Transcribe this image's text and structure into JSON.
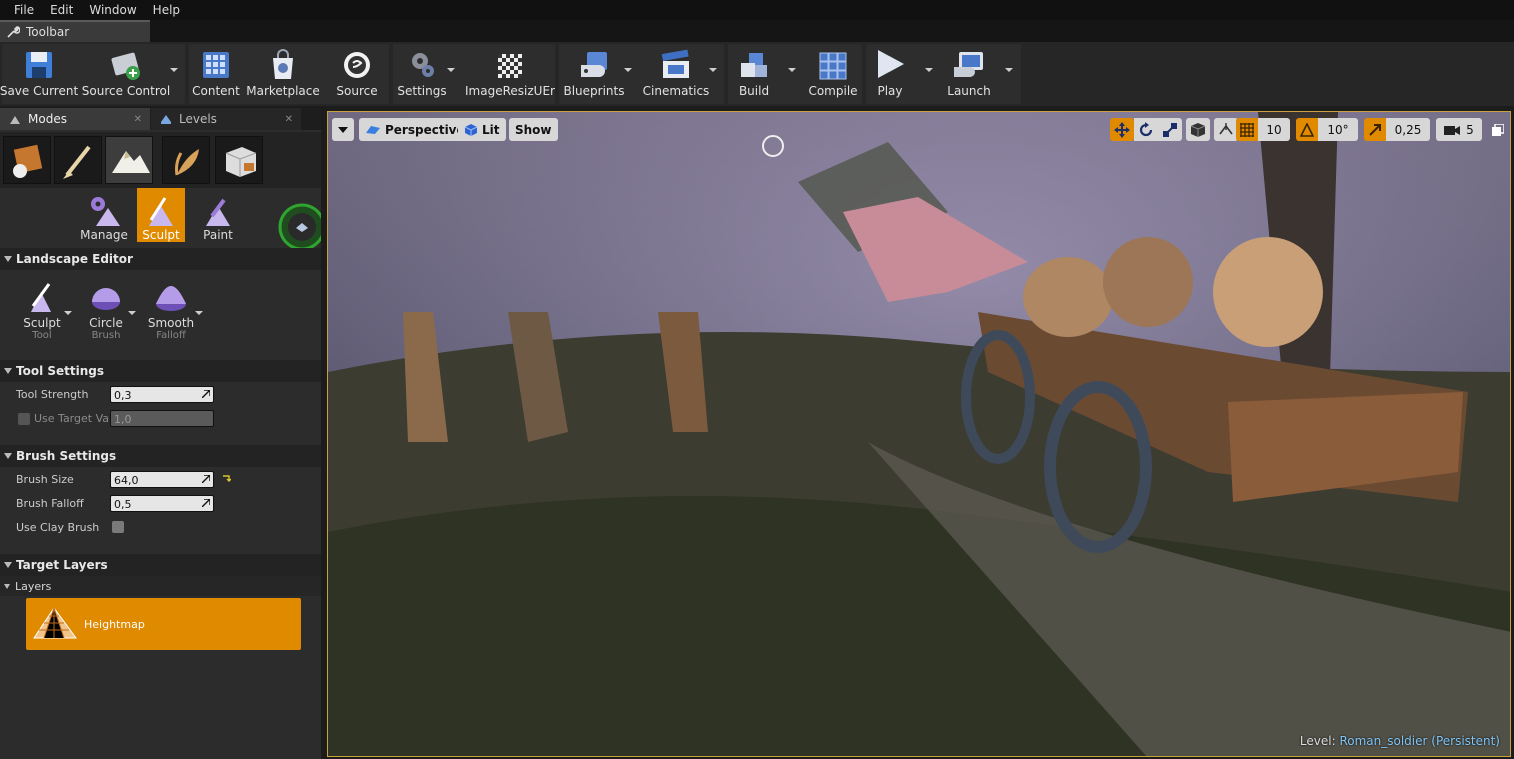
{
  "menu": [
    "File",
    "Edit",
    "Window",
    "Help"
  ],
  "toolbar_tab": {
    "label": "Toolbar"
  },
  "toolbar": {
    "save_current": "Save Current",
    "source_control": "Source Control",
    "content": "Content",
    "marketplace": "Marketplace",
    "source": "Source",
    "settings": "Settings",
    "image_resize": "ImageResizUEr",
    "blueprints": "Blueprints",
    "cinematics": "Cinematics",
    "build": "Build",
    "compile": "Compile",
    "play": "Play",
    "launch": "Launch"
  },
  "panel_tabs": {
    "modes": "Modes",
    "levels": "Levels"
  },
  "landscape_modes": {
    "manage": "Manage",
    "sculpt": "Sculpt",
    "paint": "Paint"
  },
  "sections": {
    "landscape_editor": "Landscape Editor",
    "tool_settings": "Tool Settings",
    "brush_settings": "Brush Settings",
    "target_layers": "Target Layers"
  },
  "tools": {
    "tool": {
      "label": "Sculpt",
      "sub": "Tool"
    },
    "brush": {
      "label": "Circle",
      "sub": "Brush"
    },
    "falloff": {
      "label": "Smooth",
      "sub": "Falloff"
    }
  },
  "tool_settings": {
    "tool_strength_label": "Tool Strength",
    "tool_strength_value": "0,3",
    "use_target_label": "Use Target Va",
    "use_target_value": "1,0"
  },
  "brush_settings": {
    "brush_size_label": "Brush Size",
    "brush_size_value": "64,0",
    "brush_falloff_label": "Brush Falloff",
    "brush_falloff_value": "0,5",
    "use_clay_label": "Use Clay Brush"
  },
  "layers": {
    "header": "Layers",
    "heightmap": "Heightmap"
  },
  "viewport": {
    "perspective": "Perspective",
    "lit": "Lit",
    "show": "Show",
    "grid_snap": "10",
    "rotation_snap": "10°",
    "scale_snap": "0,25",
    "camera_speed": "5",
    "level_prefix": "Level:",
    "level_name": "Roman_soldier (Persistent)"
  },
  "colors": {
    "accent": "#e08a00",
    "viewport_border": "#c7a23d",
    "level_name": "#7fc4f5"
  }
}
